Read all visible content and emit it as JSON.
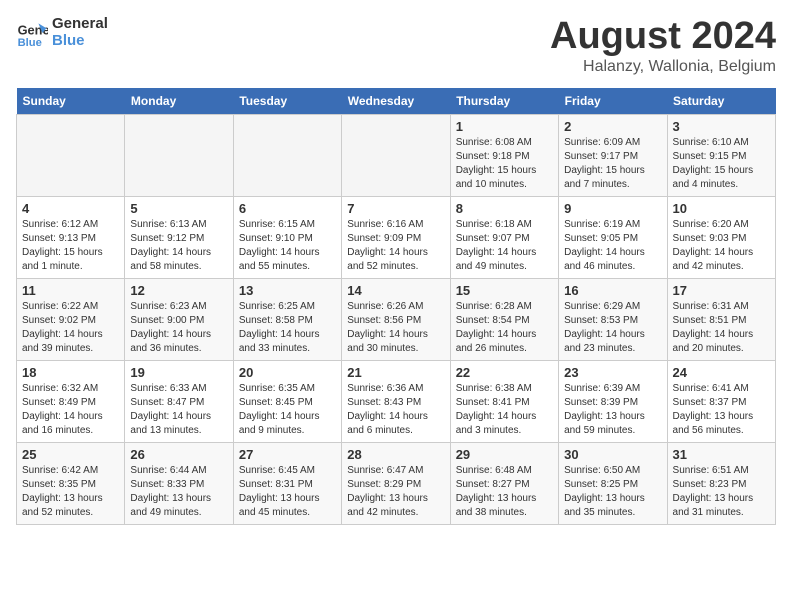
{
  "logo": {
    "line1": "General",
    "line2": "Blue"
  },
  "title": "August 2024",
  "subtitle": "Halanzy, Wallonia, Belgium",
  "days_of_week": [
    "Sunday",
    "Monday",
    "Tuesday",
    "Wednesday",
    "Thursday",
    "Friday",
    "Saturday"
  ],
  "weeks": [
    [
      {
        "day": "",
        "info": ""
      },
      {
        "day": "",
        "info": ""
      },
      {
        "day": "",
        "info": ""
      },
      {
        "day": "",
        "info": ""
      },
      {
        "day": "1",
        "info": "Sunrise: 6:08 AM\nSunset: 9:18 PM\nDaylight: 15 hours\nand 10 minutes."
      },
      {
        "day": "2",
        "info": "Sunrise: 6:09 AM\nSunset: 9:17 PM\nDaylight: 15 hours\nand 7 minutes."
      },
      {
        "day": "3",
        "info": "Sunrise: 6:10 AM\nSunset: 9:15 PM\nDaylight: 15 hours\nand 4 minutes."
      }
    ],
    [
      {
        "day": "4",
        "info": "Sunrise: 6:12 AM\nSunset: 9:13 PM\nDaylight: 15 hours\nand 1 minute."
      },
      {
        "day": "5",
        "info": "Sunrise: 6:13 AM\nSunset: 9:12 PM\nDaylight: 14 hours\nand 58 minutes."
      },
      {
        "day": "6",
        "info": "Sunrise: 6:15 AM\nSunset: 9:10 PM\nDaylight: 14 hours\nand 55 minutes."
      },
      {
        "day": "7",
        "info": "Sunrise: 6:16 AM\nSunset: 9:09 PM\nDaylight: 14 hours\nand 52 minutes."
      },
      {
        "day": "8",
        "info": "Sunrise: 6:18 AM\nSunset: 9:07 PM\nDaylight: 14 hours\nand 49 minutes."
      },
      {
        "day": "9",
        "info": "Sunrise: 6:19 AM\nSunset: 9:05 PM\nDaylight: 14 hours\nand 46 minutes."
      },
      {
        "day": "10",
        "info": "Sunrise: 6:20 AM\nSunset: 9:03 PM\nDaylight: 14 hours\nand 42 minutes."
      }
    ],
    [
      {
        "day": "11",
        "info": "Sunrise: 6:22 AM\nSunset: 9:02 PM\nDaylight: 14 hours\nand 39 minutes."
      },
      {
        "day": "12",
        "info": "Sunrise: 6:23 AM\nSunset: 9:00 PM\nDaylight: 14 hours\nand 36 minutes."
      },
      {
        "day": "13",
        "info": "Sunrise: 6:25 AM\nSunset: 8:58 PM\nDaylight: 14 hours\nand 33 minutes."
      },
      {
        "day": "14",
        "info": "Sunrise: 6:26 AM\nSunset: 8:56 PM\nDaylight: 14 hours\nand 30 minutes."
      },
      {
        "day": "15",
        "info": "Sunrise: 6:28 AM\nSunset: 8:54 PM\nDaylight: 14 hours\nand 26 minutes."
      },
      {
        "day": "16",
        "info": "Sunrise: 6:29 AM\nSunset: 8:53 PM\nDaylight: 14 hours\nand 23 minutes."
      },
      {
        "day": "17",
        "info": "Sunrise: 6:31 AM\nSunset: 8:51 PM\nDaylight: 14 hours\nand 20 minutes."
      }
    ],
    [
      {
        "day": "18",
        "info": "Sunrise: 6:32 AM\nSunset: 8:49 PM\nDaylight: 14 hours\nand 16 minutes."
      },
      {
        "day": "19",
        "info": "Sunrise: 6:33 AM\nSunset: 8:47 PM\nDaylight: 14 hours\nand 13 minutes."
      },
      {
        "day": "20",
        "info": "Sunrise: 6:35 AM\nSunset: 8:45 PM\nDaylight: 14 hours\nand 9 minutes."
      },
      {
        "day": "21",
        "info": "Sunrise: 6:36 AM\nSunset: 8:43 PM\nDaylight: 14 hours\nand 6 minutes."
      },
      {
        "day": "22",
        "info": "Sunrise: 6:38 AM\nSunset: 8:41 PM\nDaylight: 14 hours\nand 3 minutes."
      },
      {
        "day": "23",
        "info": "Sunrise: 6:39 AM\nSunset: 8:39 PM\nDaylight: 13 hours\nand 59 minutes."
      },
      {
        "day": "24",
        "info": "Sunrise: 6:41 AM\nSunset: 8:37 PM\nDaylight: 13 hours\nand 56 minutes."
      }
    ],
    [
      {
        "day": "25",
        "info": "Sunrise: 6:42 AM\nSunset: 8:35 PM\nDaylight: 13 hours\nand 52 minutes."
      },
      {
        "day": "26",
        "info": "Sunrise: 6:44 AM\nSunset: 8:33 PM\nDaylight: 13 hours\nand 49 minutes."
      },
      {
        "day": "27",
        "info": "Sunrise: 6:45 AM\nSunset: 8:31 PM\nDaylight: 13 hours\nand 45 minutes."
      },
      {
        "day": "28",
        "info": "Sunrise: 6:47 AM\nSunset: 8:29 PM\nDaylight: 13 hours\nand 42 minutes."
      },
      {
        "day": "29",
        "info": "Sunrise: 6:48 AM\nSunset: 8:27 PM\nDaylight: 13 hours\nand 38 minutes."
      },
      {
        "day": "30",
        "info": "Sunrise: 6:50 AM\nSunset: 8:25 PM\nDaylight: 13 hours\nand 35 minutes."
      },
      {
        "day": "31",
        "info": "Sunrise: 6:51 AM\nSunset: 8:23 PM\nDaylight: 13 hours\nand 31 minutes."
      }
    ]
  ]
}
